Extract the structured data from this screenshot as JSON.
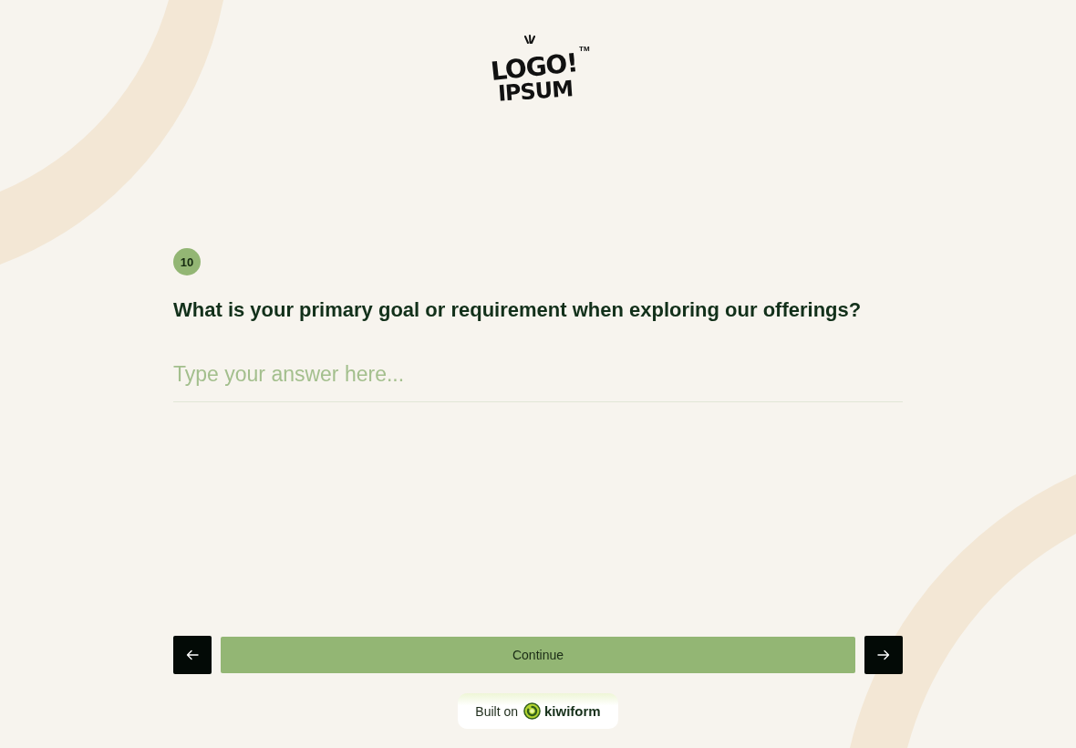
{
  "logo": {
    "line_1": "LOGO!",
    "line_2": "IPSUM",
    "trademark": "TM"
  },
  "question": {
    "number": "10",
    "text": "What is your primary goal or requirement when exploring our offerings?"
  },
  "answer": {
    "placeholder": "Type your answer here..."
  },
  "navigation": {
    "continue_label": "Continue"
  },
  "footer": {
    "built_on": "Built on",
    "brand": "kiwiform"
  }
}
